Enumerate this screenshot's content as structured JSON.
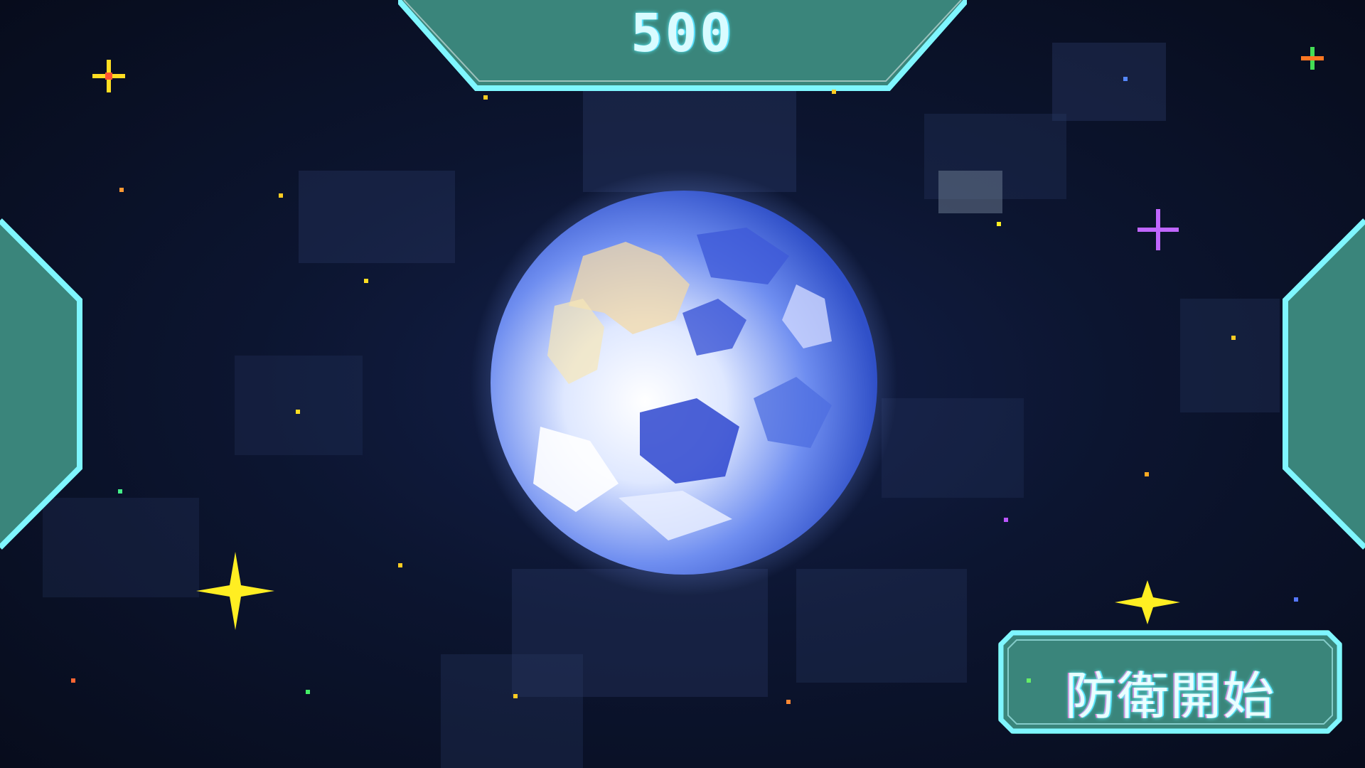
{
  "hud": {
    "score": "500",
    "start_button_label": "防衛開始"
  },
  "colors": {
    "panel_fill": "#3f8f82",
    "panel_border": "#7ff6ff",
    "space_bg": "#0b1224",
    "star_yellow": "#ffee22",
    "star_purple": "#c066ff"
  },
  "icons": {
    "planet": "earth-planet-icon",
    "sparkle_large": "four-point-star-icon",
    "sparkle_small": "plus-star-icon"
  }
}
